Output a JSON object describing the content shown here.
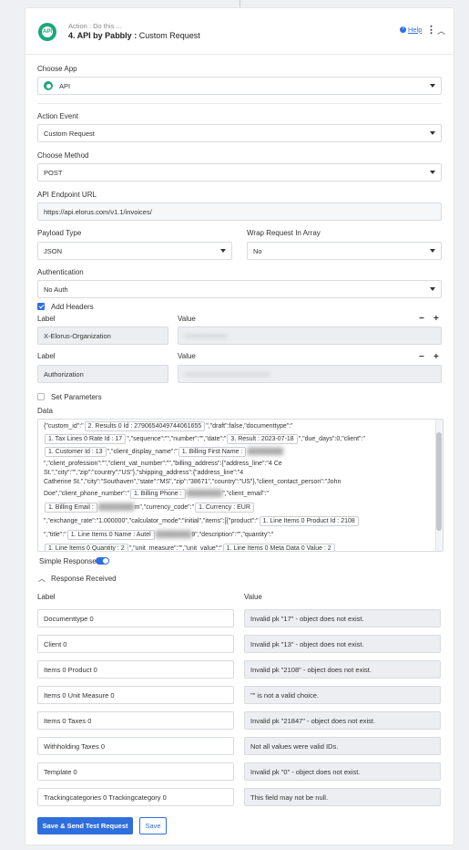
{
  "header": {
    "subtitle": "Action : Do this ...",
    "step": "4. API by Pabbly :",
    "action_name": "Custom Request",
    "help_label": "Help"
  },
  "choose_app": {
    "label": "Choose App",
    "value": "API"
  },
  "action_event": {
    "label": "Action Event",
    "value": "Custom Request"
  },
  "choose_method": {
    "label": "Choose Method",
    "value": "POST"
  },
  "endpoint": {
    "label": "API Endpoint URL",
    "value": "https://api.elorus.com/v1.1/invoices/"
  },
  "payload_type": {
    "label": "Payload Type",
    "value": "JSON"
  },
  "wrap_request": {
    "label": "Wrap Request In Array",
    "value": "No"
  },
  "authentication": {
    "label": "Authentication",
    "value": "No Auth"
  },
  "add_headers": {
    "label": "Add Headers",
    "checked": true
  },
  "headers": [
    {
      "label_title": "Label",
      "value_title": "Value",
      "label": "X-Elorus-Organization",
      "value": "••••••••••••••••••"
    },
    {
      "label_title": "Label",
      "value_title": "Value",
      "label": "Authorization",
      "value": "••••••••••••••••••••••••••••••••••••"
    }
  ],
  "set_parameters": {
    "label": "Set Parameters",
    "checked": false
  },
  "data": {
    "label": "Data",
    "lines": [
      [
        "{\"custom_id\":\"",
        "2. Results 0 Id : 2790654049744061655",
        "\",\"draft\":false,\"documenttype\":\""
      ],
      [
        "",
        "1. Tax Lines 0 Rate Id : 17",
        "\",\"sequence\":\"\",\"number\":\"\",\"date\":\"",
        "3. Result : 2023-07-18",
        "\",\"due_days\":0,\"client\":\""
      ],
      [
        "",
        "1. Customer Id : 13",
        "\",\"client_display_name\":\"",
        "1. Billing First Name :",
        ""
      ],
      [
        "\",\"client_profession\":\"\",\"client_vat_number\":\"\",\"billing_address\":{\"address_line\":\"4 C",
        "",
        "e"
      ],
      [
        "St.\",\"city\":\"",
        "",
        "\",\"zip\":\"",
        "",
        "country\":\"US\"},\"shipping_address\":{\"address_line\":\"4"
      ],
      [
        "Catherine St.\",\"city\":\"Southaven\",\"state\":\"MS\",\"zip\":\"38671\",\"country\":\"US\"},\"client_contact_person\":\"John"
      ],
      [
        "Doe\",\"client_phone_number\":\"",
        "1. Billing Phone :",
        "",
        "\",\"client_email\":\""
      ],
      [
        "",
        "1. Billing Email :",
        "m",
        "\",\"currency_code\":\"",
        "1. Currency : EUR"
      ],
      [
        "\",\"exchange_rate\":\"1.000000\",\"calculator_mode\":\"initial\",\"items\":[{\"product\":\"",
        "1. Line Items 0 Product Id : 2108"
      ],
      [
        "\",\"title\":\"",
        "1. Line Items 0 Name : Autel",
        "9",
        "\",\"description\":\"\",\"quantity\":\""
      ],
      [
        "",
        "1. Line Items 0 Quantity : 2",
        "\",\"unit_measure\":\"\",\"unit_value\":\"",
        "1. Line Items 0 Meta Data 0 Value : 2"
      ]
    ]
  },
  "simple_response": {
    "label": "Simple Response",
    "on": true
  },
  "response_received": {
    "title": "Response Received",
    "label_header": "Label",
    "value_header": "Value",
    "rows": [
      {
        "label": "Documenttype 0",
        "value": "Invalid pk \"17\" - object does not exist."
      },
      {
        "label": "Client 0",
        "value": "Invalid pk \"13\" - object does not exist."
      },
      {
        "label": "Items 0 Product 0",
        "value": "Invalid pk \"2108\" - object does not exist."
      },
      {
        "label": "Items 0 Unit Measure 0",
        "value": "\"\" is not a valid choice."
      },
      {
        "label": "Items 0 Taxes 0",
        "value": "Invalid pk \"21847\" - object does not exist."
      },
      {
        "label": "Withholding Taxes 0",
        "value": "Not all values were valid IDs."
      },
      {
        "label": "Template 0",
        "value": "Invalid pk \"0\" - object does not exist."
      },
      {
        "label": "Trackingcategories 0 Trackingcategory 0",
        "value": "This field may not be null."
      }
    ]
  },
  "buttons": {
    "save_send": "Save & Send Test Request",
    "save": "Save"
  },
  "colors": {
    "accent": "#2f6fdc",
    "brand": "#1aa87a"
  }
}
